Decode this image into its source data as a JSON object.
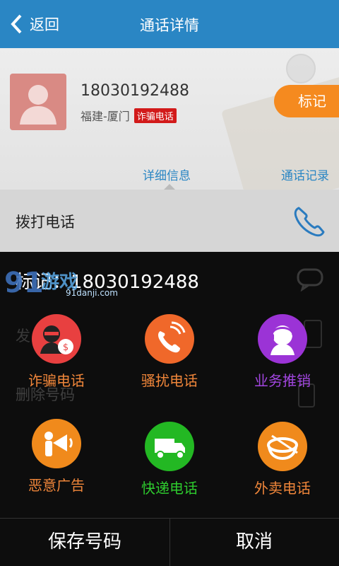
{
  "header": {
    "back_label": "返回",
    "title": "通话详情"
  },
  "contact": {
    "number": "18030192488",
    "location": "福建-厦门",
    "tag": "诈骗电话",
    "mark_button": "标记"
  },
  "tabs": {
    "detail": "详细信息",
    "log": "通话记录"
  },
  "call_row": {
    "label": "拨打电话"
  },
  "ghost": {
    "row2_label": "发",
    "row3_label": "删除号码"
  },
  "sheet": {
    "title": "标记：18030192488",
    "options": [
      {
        "label": "诈骗电话",
        "color": "#e84040",
        "label_color": "#f0863a",
        "icon": "thief-icon"
      },
      {
        "label": "骚扰电话",
        "color": "#f0682a",
        "label_color": "#f0863a",
        "icon": "phone-ring-icon"
      },
      {
        "label": "业务推销",
        "color": "#9b33d6",
        "label_color": "#a246e0",
        "icon": "agent-icon"
      },
      {
        "label": "恶意广告",
        "color": "#f08a1c",
        "label_color": "#f0863a",
        "icon": "megaphone-icon"
      },
      {
        "label": "快递电话",
        "color": "#23b823",
        "label_color": "#2ecc2e",
        "icon": "truck-icon"
      },
      {
        "label": "外卖电话",
        "color": "#f08a1c",
        "label_color": "#f0863a",
        "icon": "bowl-icon"
      }
    ],
    "save_button": "保存号码",
    "cancel_button": "取消"
  },
  "watermark": {
    "brand": "91游戏",
    "url": "91danji.com"
  }
}
